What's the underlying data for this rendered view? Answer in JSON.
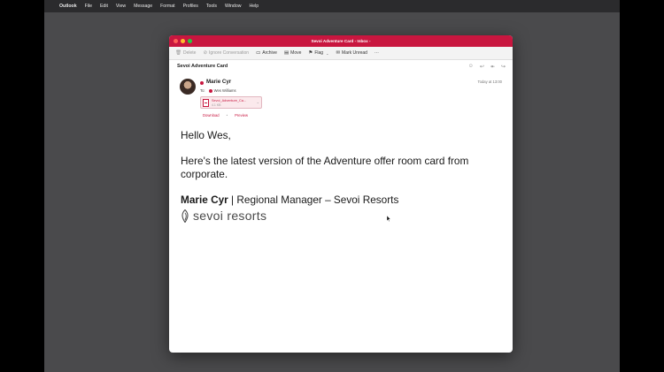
{
  "menubar": {
    "apple": "",
    "app": "Outlook",
    "items": [
      "File",
      "Edit",
      "View",
      "Message",
      "Format",
      "Profiles",
      "Tools",
      "Window",
      "Help"
    ]
  },
  "window": {
    "title": "Sevoi Adventure Card - Inbox -",
    "accent": "#c8163f"
  },
  "toolbar": {
    "delete": "Delete",
    "ignore": "Ignore Conversation",
    "archive": "Archive",
    "move": "Move",
    "flag": "Flag",
    "mark_unread": "Mark Unread",
    "more": "···"
  },
  "message": {
    "subject": "Sevoi Adventure Card",
    "sender": "Marie Cyr",
    "date": "Today at 13:00",
    "to_label": "To:",
    "to_name": "Wes Williams",
    "attachment": {
      "name": "Sevoi_Adventure_Ca...",
      "size": "4.1 KB",
      "download": "Download",
      "preview": "Preview"
    },
    "greeting": "Hello Wes,",
    "body": "Here's the latest version of the Adventure offer room card from corporate.",
    "signature_name": "Marie Cyr",
    "signature_title": " | Regional Manager – Sevoi Resorts",
    "logo_text": "sevoi resorts"
  }
}
